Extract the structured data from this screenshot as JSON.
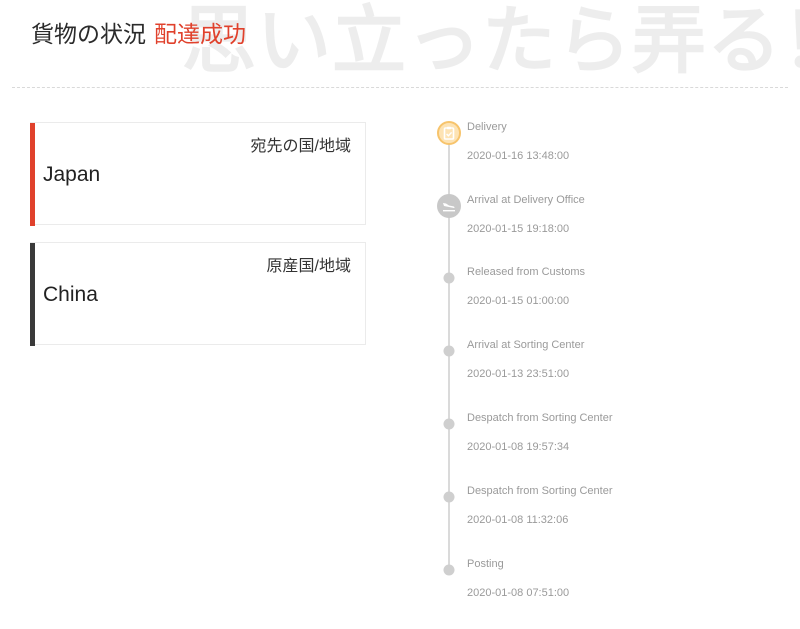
{
  "header": {
    "title": "貨物の状況",
    "status": "配達成功",
    "watermark": "思い立ったら弄る！"
  },
  "destination": {
    "label": "宛先の国/地域",
    "value": "Japan",
    "accent_color": "#e0412c"
  },
  "origin": {
    "label": "原産国/地域",
    "value": "China",
    "accent_color": "#3a3a3a"
  },
  "timeline": [
    {
      "title": "Delivery",
      "time": "2020-01-16 13:48:00",
      "icon": "delivered-icon"
    },
    {
      "title": "Arrival at Delivery Office",
      "time": "2020-01-15 19:18:00",
      "icon": "airplane-landing-icon"
    },
    {
      "title": "Released from Customs",
      "time": "2020-01-15 01:00:00",
      "icon": "dot"
    },
    {
      "title": "Arrival at Sorting Center",
      "time": "2020-01-13 23:51:00",
      "icon": "dot"
    },
    {
      "title": "Despatch from Sorting Center",
      "time": "2020-01-08 19:57:34",
      "icon": "dot"
    },
    {
      "title": "Despatch from Sorting Center",
      "time": "2020-01-08 11:32:06",
      "icon": "dot"
    },
    {
      "title": "Posting",
      "time": "2020-01-08 07:51:00",
      "icon": "dot"
    }
  ],
  "colors": {
    "status_red": "#e0412c",
    "delivered_yellow": "#f7c46c",
    "muted_gray": "#9a9a9a"
  }
}
